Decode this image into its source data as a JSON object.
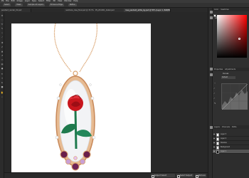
{
  "menubar": {
    "items": [
      "PS",
      "File",
      "Edit",
      "Image",
      "Layer",
      "Type",
      "Select",
      "Filter",
      "3D",
      "View",
      "Window",
      "Help"
    ]
  },
  "options": {
    "items": [
      "Select",
      "Mask",
      "Sample All Layers",
      "Enhance Edge",
      "Refine"
    ]
  },
  "tabs": [
    {
      "label": "pendant_render_01.psd"
    },
    {
      "label": "necklace_rose_final.psd @ 33.3% (RGB/8)"
    },
    {
      "label": "PS_ZX1001_detail.psd"
    },
    {
      "label": "rose_pendant_white_bg.psd @ 50% (Layer 1, RGB/8#)"
    }
  ],
  "status": {
    "buttons": [
      "Subject Select",
      "Select Subject",
      "Remove"
    ]
  },
  "panels": {
    "color_tabs": [
      "Color",
      "Swatches"
    ],
    "properties_tabs": [
      "Properties",
      "Adjustments"
    ],
    "properties_title": "Curves",
    "preset": "Default",
    "layers_tabs": [
      "Layers",
      "Channels",
      "Paths"
    ],
    "layers": [
      {
        "name": "Layer 3"
      },
      {
        "name": "Layer 2"
      },
      {
        "name": "Shadow"
      },
      {
        "name": "Background"
      },
      {
        "name": "Layer 1"
      }
    ]
  },
  "colors": {
    "foreground": "#ffffff",
    "background": "#000000",
    "selected_hue": "#ff0000",
    "rose": "#c8161d",
    "stem": "#1f7a4d",
    "gold": "#d9a06b"
  },
  "icons": {
    "tools": [
      "move-icon",
      "marquee-icon",
      "lasso-icon",
      "quick-select-icon",
      "crop-icon",
      "eyedropper-icon",
      "heal-icon",
      "brush-icon",
      "stamp-icon",
      "history-brush-icon",
      "eraser-icon",
      "gradient-icon",
      "dodge-icon",
      "pen-icon",
      "type-icon",
      "path-select-icon",
      "shape-icon",
      "hand-icon",
      "zoom-icon"
    ]
  }
}
